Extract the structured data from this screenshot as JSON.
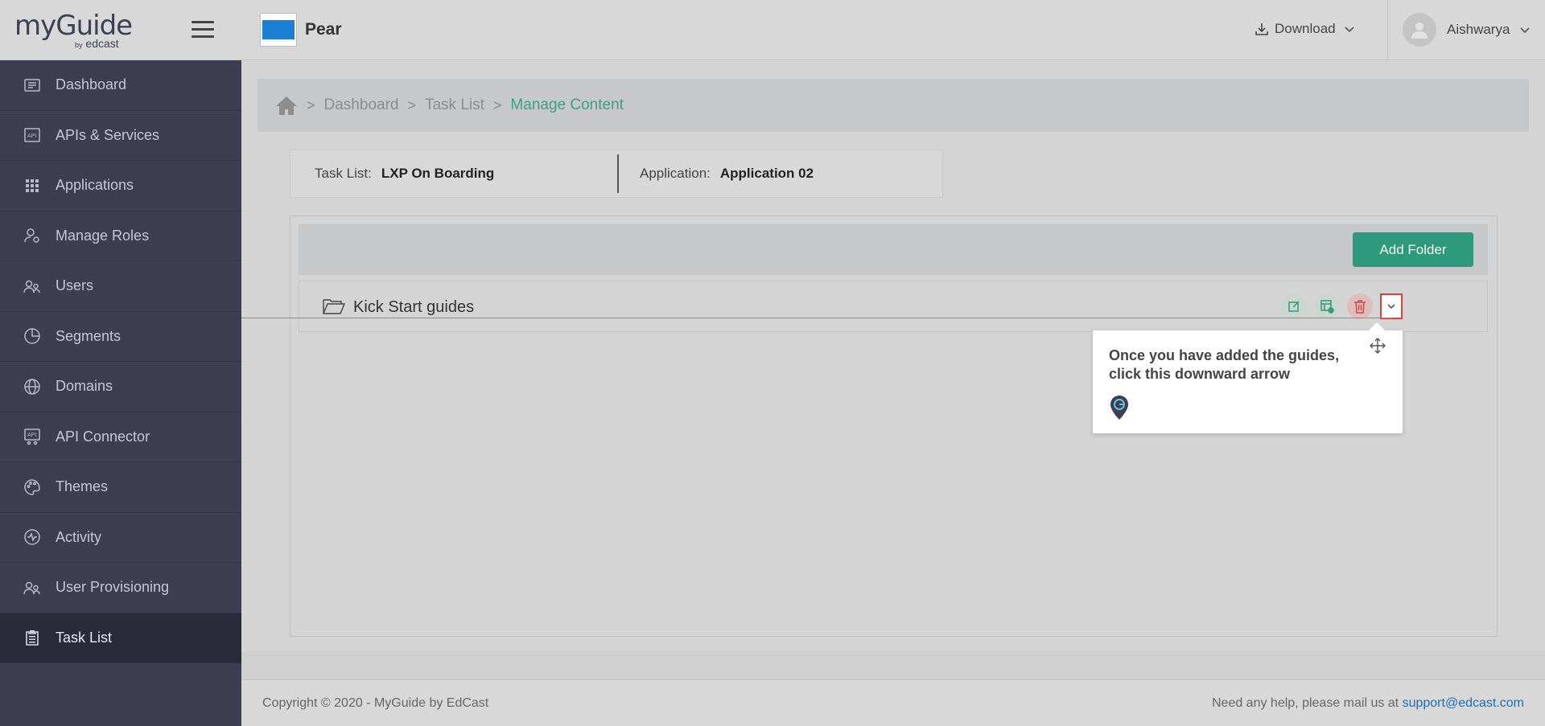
{
  "logo": {
    "main": "myGuide",
    "by": "by",
    "brand": "edcast"
  },
  "sidebar": {
    "items": [
      {
        "label": "Dashboard",
        "icon": "dashboard-icon"
      },
      {
        "label": "APIs & Services",
        "icon": "api-icon"
      },
      {
        "label": "Applications",
        "icon": "grid-icon"
      },
      {
        "label": "Manage Roles",
        "icon": "roles-icon"
      },
      {
        "label": "Users",
        "icon": "users-icon"
      },
      {
        "label": "Segments",
        "icon": "pie-icon"
      },
      {
        "label": "Domains",
        "icon": "globe-icon"
      },
      {
        "label": "API Connector",
        "icon": "api-connector-icon"
      },
      {
        "label": "Themes",
        "icon": "palette-icon"
      },
      {
        "label": "Activity",
        "icon": "activity-icon"
      },
      {
        "label": "User Provisioning",
        "icon": "user-provisioning-icon"
      },
      {
        "label": "Task List",
        "icon": "clipboard-icon",
        "active": true
      }
    ]
  },
  "header": {
    "app_name": "Pear",
    "app_color": "#1b7fd3",
    "download_label": "Download",
    "user_name": "Aishwarya"
  },
  "breadcrumb": {
    "items": [
      "Dashboard",
      "Task List"
    ],
    "current": "Manage Content"
  },
  "info": {
    "task_list_key": "Task List:",
    "task_list_value": "LXP On Boarding",
    "application_key": "Application:",
    "application_value": "Application 02"
  },
  "panel": {
    "add_folder_label": "Add Folder",
    "folder_name": "Kick Start guides"
  },
  "tooltip": {
    "text": "Once you have added the guides, click this downward arrow"
  },
  "footer": {
    "copyright": "Copyright © 2020 - MyGuide by EdCast",
    "help_text": "Need any help, please mail us at",
    "help_email": "support@edcast.com"
  },
  "colors": {
    "accent": "#2f9a7b",
    "sidebar": "#3d3e52",
    "breadcrumb_current": "#3fa07f",
    "link": "#1f6fb8"
  }
}
